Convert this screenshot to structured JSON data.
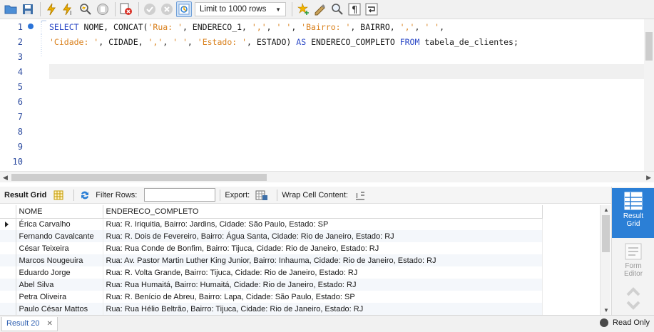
{
  "toolbar": {
    "limit_label": "Limit to 1000 rows",
    "icons": [
      "folder-icon",
      "save-icon",
      "execute-icon",
      "execute-current-icon",
      "explain-icon",
      "stop-icon",
      "toggle-error-icon",
      "commit-icon",
      "rollback-icon",
      "autocommit-icon",
      "beautify-icon",
      "snippet-icon",
      "find-icon",
      "invisible-chars-icon",
      "wrap-icon"
    ]
  },
  "editor": {
    "line_numbers": [
      "1",
      "2",
      "3",
      "4",
      "5",
      "6",
      "7",
      "8",
      "9",
      "10"
    ],
    "lines": [
      [
        {
          "t": "SELECT",
          "c": "kw"
        },
        {
          "t": " NOME, CONCAT(",
          "c": ""
        },
        {
          "t": "'Rua: '",
          "c": "str"
        },
        {
          "t": ", ENDERECO_1, ",
          "c": ""
        },
        {
          "t": "','",
          "c": "str"
        },
        {
          "t": ", ",
          "c": ""
        },
        {
          "t": "' '",
          "c": "str"
        },
        {
          "t": ", ",
          "c": ""
        },
        {
          "t": "'Bairro: '",
          "c": "str"
        },
        {
          "t": ", BAIRRO, ",
          "c": ""
        },
        {
          "t": "','",
          "c": "str"
        },
        {
          "t": ", ",
          "c": ""
        },
        {
          "t": "' '",
          "c": "str"
        },
        {
          "t": ",",
          "c": ""
        }
      ],
      [
        {
          "t": "'Cidade: '",
          "c": "str"
        },
        {
          "t": ", CIDADE, ",
          "c": ""
        },
        {
          "t": "','",
          "c": "str"
        },
        {
          "t": ", ",
          "c": ""
        },
        {
          "t": "' '",
          "c": "str"
        },
        {
          "t": ", ",
          "c": ""
        },
        {
          "t": "'Estado: '",
          "c": "str"
        },
        {
          "t": ", ESTADO) ",
          "c": ""
        },
        {
          "t": "AS",
          "c": "kw"
        },
        {
          "t": " ENDERECO_COMPLETO ",
          "c": ""
        },
        {
          "t": "FROM",
          "c": "kw"
        },
        {
          "t": " tabela_de_clientes;",
          "c": ""
        }
      ]
    ]
  },
  "result_toolbar": {
    "result_grid_label": "Result Grid",
    "filter_rows_label": "Filter Rows:",
    "filter_value": "",
    "export_label": "Export:",
    "wrap_label": "Wrap Cell Content:"
  },
  "grid": {
    "columns": [
      "NOME",
      "ENDERECO_COMPLETO"
    ],
    "rows": [
      [
        "Érica Carvalho",
        "Rua: R. Iriquitia, Bairro: Jardins, Cidade: São Paulo, Estado: SP"
      ],
      [
        "Fernando Cavalcante",
        "Rua: R. Dois de Fevereiro, Bairro: Água Santa, Cidade: Rio de Janeiro, Estado: RJ"
      ],
      [
        "César Teixeira",
        "Rua: Rua Conde de Bonfim, Bairro: Tijuca, Cidade: Rio de Janeiro, Estado: RJ"
      ],
      [
        "Marcos Nougeuira",
        "Rua: Av. Pastor Martin Luther King Junior, Bairro: Inhauma, Cidade: Rio de Janeiro, Estado: RJ"
      ],
      [
        "Eduardo Jorge",
        "Rua: R. Volta Grande, Bairro: Tijuca, Cidade: Rio de Janeiro, Estado: RJ"
      ],
      [
        "Abel Silva",
        "Rua: Rua Humaitá, Bairro: Humaitá, Cidade: Rio de Janeiro, Estado: RJ"
      ],
      [
        "Petra Oliveira",
        "Rua: R. Benício de Abreu, Bairro: Lapa, Cidade: São Paulo, Estado: SP"
      ],
      [
        "Paulo César Mattos",
        "Rua: Rua Hélio Beltrão, Bairro: Tijuca, Cidade: Rio de Janeiro, Estado: RJ"
      ]
    ]
  },
  "side_panel": {
    "result_grid_label_1": "Result",
    "result_grid_label_2": "Grid",
    "form_editor_label_1": "Form",
    "form_editor_label_2": "Editor"
  },
  "status": {
    "tab_label": "Result 20",
    "read_only_label": "Read Only"
  },
  "colors": {
    "keyword": "#2a47c5",
    "string": "#d9801c",
    "accent": "#2b7fd6"
  }
}
